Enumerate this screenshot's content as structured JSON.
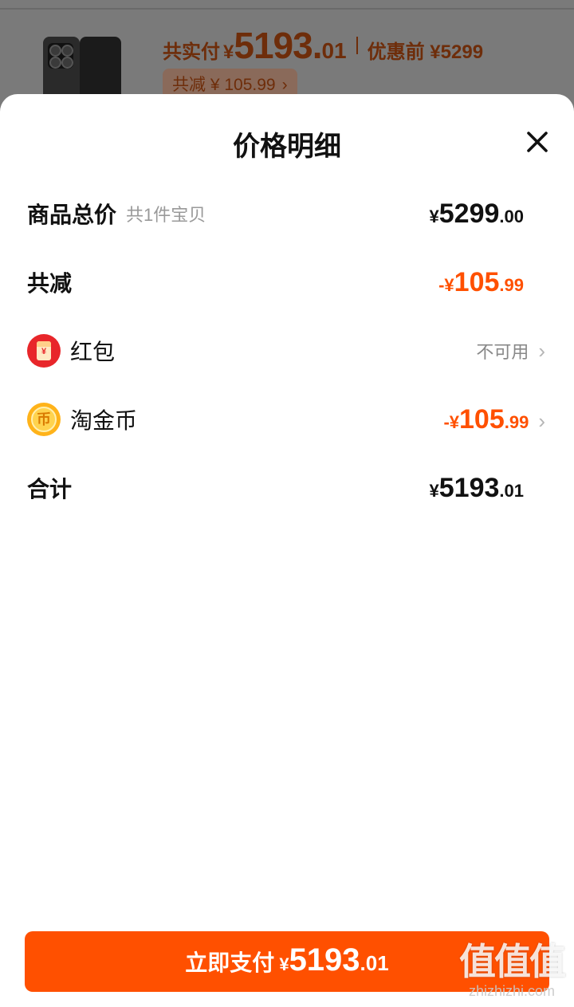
{
  "order_header": {
    "paid_label": "共实付",
    "currency": "¥",
    "paid_int": "5193.",
    "paid_dec": "01",
    "orig_label": "优惠前 ¥5299",
    "reduce_chip": "共减 ¥ 105.99",
    "chevron": "›"
  },
  "sheet": {
    "title": "价格明细",
    "close_icon": "close-icon"
  },
  "rows": {
    "subtotal": {
      "label": "商品总价",
      "sub": "共1件宝贝",
      "currency": "¥",
      "int": "5299",
      "dec": ".00"
    },
    "discount": {
      "label": "共减",
      "currency": "-¥",
      "int": "105",
      "dec": ".99"
    },
    "red_packet": {
      "label": "红包",
      "status": "不可用",
      "icon": "red-packet-icon"
    },
    "taojinbi": {
      "label": "淘金币",
      "currency": "-¥",
      "int": "105",
      "dec": ".99",
      "icon": "coin-icon",
      "icon_glyph": "币"
    },
    "total": {
      "label": "合计",
      "currency": "¥",
      "int": "5193",
      "dec": ".01"
    }
  },
  "chevron": "›",
  "red_packet_glyph": "¥",
  "pay_button": {
    "label": "立即支付",
    "currency": "¥",
    "int": "5193",
    "dec": ".01"
  },
  "watermark": {
    "big": "值值值",
    "small": "zhizhizhi.com"
  },
  "colors": {
    "accent": "#ff5000",
    "text": "#111111",
    "muted": "#999999"
  }
}
